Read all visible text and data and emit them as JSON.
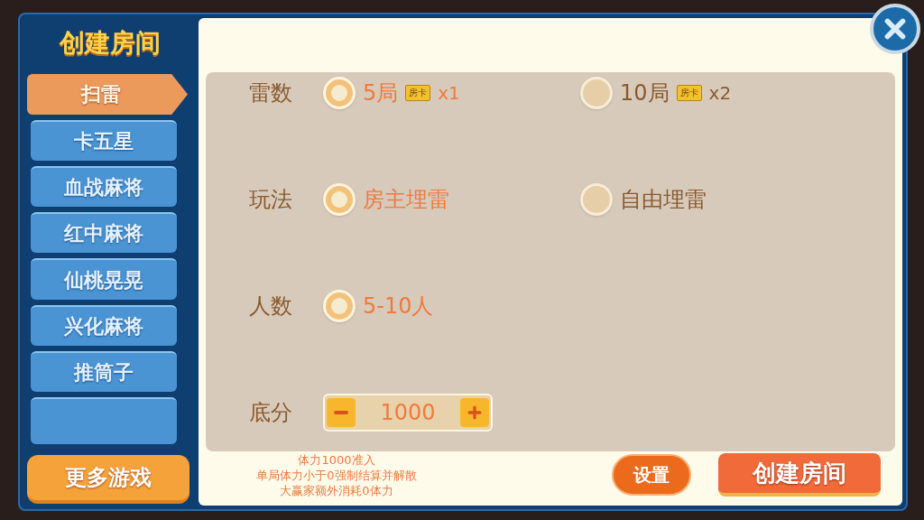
{
  "dialog": {
    "title": "创建房间"
  },
  "games": [
    {
      "label": "扫雷",
      "selected": true
    },
    {
      "label": "卡五星",
      "selected": false
    },
    {
      "label": "血战麻将",
      "selected": false
    },
    {
      "label": "红中麻将",
      "selected": false
    },
    {
      "label": "仙桃晃晃",
      "selected": false
    },
    {
      "label": "兴化麻将",
      "selected": false
    },
    {
      "label": "推筒子",
      "selected": false
    }
  ],
  "more_games_button": "更多游戏",
  "settings": [
    {
      "kind": "radio",
      "label": "雷数",
      "options": [
        {
          "label": "5局",
          "selected": true,
          "card": "房卡",
          "cost": "x1"
        },
        {
          "label": "10局",
          "selected": false,
          "card": "房卡",
          "cost": "x2"
        }
      ]
    },
    {
      "kind": "radio",
      "label": "玩法",
      "options": [
        {
          "label": "房主埋雷",
          "selected": true
        },
        {
          "label": "自由埋雷",
          "selected": false
        }
      ]
    },
    {
      "kind": "radio",
      "label": "人数",
      "options": [
        {
          "label": "5-10人",
          "selected": true
        }
      ]
    },
    {
      "kind": "stepper",
      "label": "底分",
      "value": "1000"
    }
  ],
  "notes": [
    "体力1000准入",
    "单局体力小于0强制结算并解散",
    "大赢家额外消耗0体力"
  ],
  "settings_button": "设置",
  "create_button": "创建房间"
}
